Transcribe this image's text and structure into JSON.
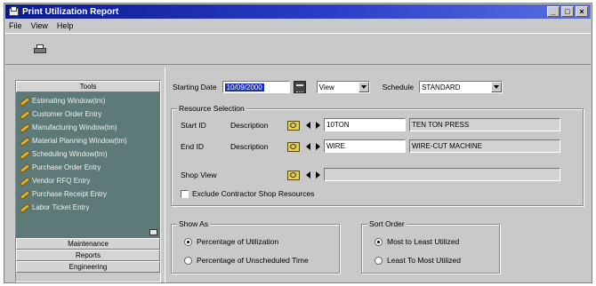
{
  "window": {
    "title": "Print Utilization Report",
    "controls": [
      "_",
      "□",
      "×"
    ]
  },
  "menu": [
    "File",
    "View",
    "Help"
  ],
  "toolbar": {
    "print_icon": "printer-icon"
  },
  "sidebar": {
    "tools_header": "Tools",
    "tools": [
      "Estimating Window(tm)",
      "Customer Order Entry",
      "Manufacturing Window(tm)",
      "Material Planning Window(tm)",
      "Scheduling Window(tm)",
      "Purchase Order Entry",
      "Vendor RFQ Entry",
      "Purchase Receipt Entry",
      "Labor Ticket Entry"
    ],
    "sections": [
      "Maintenance",
      "Reports",
      "Engineering"
    ]
  },
  "form": {
    "starting_date_label": "Starting Date",
    "starting_date_value": "10/09/2000",
    "view_value": "View",
    "schedule_label": "Schedule",
    "schedule_value": "STANDARD",
    "resource_selection": {
      "legend": "Resource Selection",
      "start_id_label": "Start ID",
      "start_desc_label": "Description",
      "start_id_value": "10TON",
      "start_desc_value": "TEN TON PRESS",
      "end_id_label": "End ID",
      "end_desc_label": "Description",
      "end_id_value": "WIRE",
      "end_desc_value": "WIRE-CUT MACHINE",
      "shop_view_label": "Shop View",
      "exclude_label": "Exclude Contractor Shop Resources"
    },
    "show_as": {
      "legend": "Show As",
      "options": [
        "Percentage of Utilization",
        "Percentage of Unscheduled Time"
      ],
      "selected": 0
    },
    "sort_order": {
      "legend": "Sort Order",
      "options": [
        "Most to Least Utilized",
        "Least To Most Utilized"
      ],
      "selected": 0
    }
  },
  "colors": {
    "title_bar": "#0a1a8c",
    "tools_panel": "#5d7a78",
    "selection": "#1c2fb0",
    "window_face": "#c9c9c9"
  }
}
